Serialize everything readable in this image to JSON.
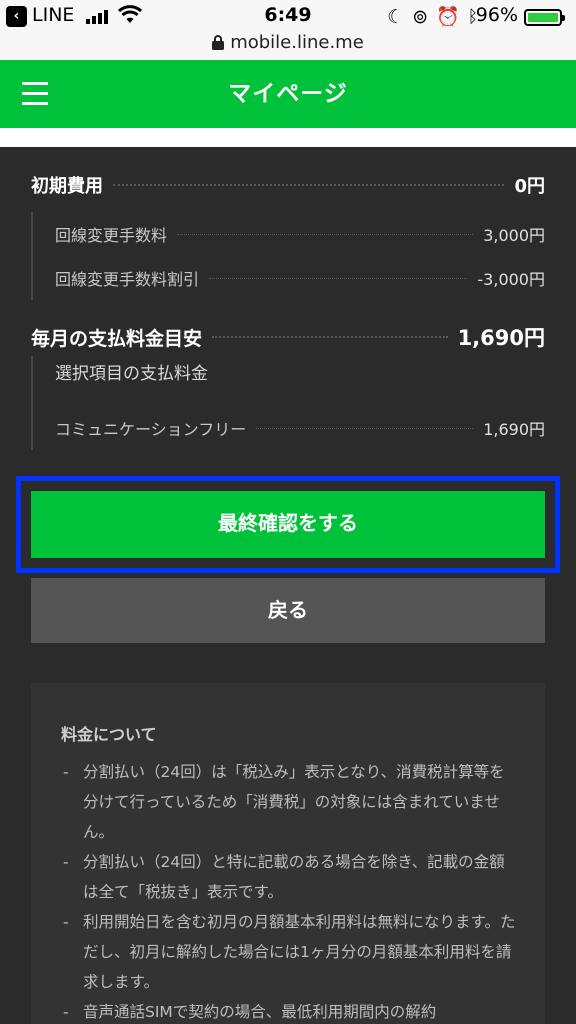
{
  "status_bar": {
    "carrier": "LINE",
    "time": "6:49",
    "battery": "96%"
  },
  "url_bar": {
    "domain": "mobile.line.me"
  },
  "header": {
    "title": "マイページ"
  },
  "initial_fees": {
    "label": "初期費用",
    "value": "0円",
    "items": [
      {
        "label": "回線変更手数料",
        "value": "3,000円"
      },
      {
        "label": "回線変更手数料割引",
        "value": "-3,000円"
      }
    ]
  },
  "monthly_fees": {
    "label": "毎月の支払料金目安",
    "value": "1,690円",
    "subheading": "選択項目の支払料金",
    "items": [
      {
        "label": "コミュニケーションフリー",
        "value": "1,690円"
      }
    ]
  },
  "buttons": {
    "confirm": "最終確認をする",
    "back": "戻る"
  },
  "notes": {
    "title": "料金について",
    "items": [
      "分割払い（24回）は「税込み」表示となり、消費税計算等を分けて行っているため「消費税」の対象には含まれていません。",
      "分割払い（24回）と特に記載のある場合を除き、記載の金額は全て「税抜き」表示です。",
      "利用開始日を含む初月の月額基本利用料は無料になります。ただし、初月に解約した場合には1ヶ月分の月額基本利用料を請求します。",
      "音声通話SIMで契約の場合、最低利用期間内の解約"
    ]
  },
  "colors": {
    "brand_green": "#00c13a",
    "highlight_blue": "#0033ff",
    "background": "#2b2b2b"
  }
}
